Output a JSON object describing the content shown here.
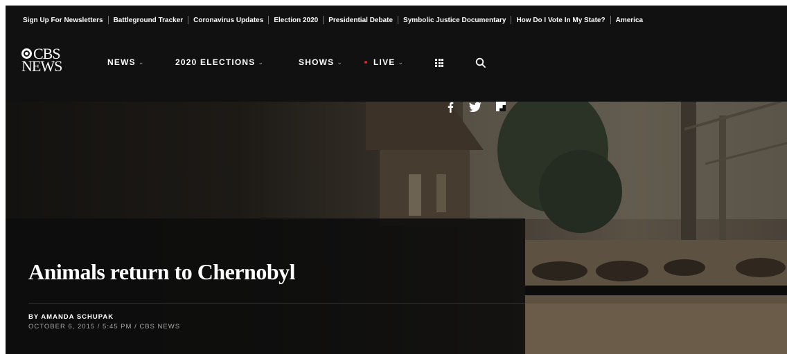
{
  "topbar": {
    "links": [
      "Sign Up For Newsletters",
      "Battleground Tracker",
      "Coronavirus Updates",
      "Election 2020",
      "Presidential Debate",
      "Symbolic Justice Documentary",
      "How Do I Vote In My State?",
      "America"
    ]
  },
  "logo": {
    "line1": "CBS",
    "line2": "NEWS"
  },
  "nav": {
    "news": "NEWS",
    "elections": "2020 ELECTIONS",
    "shows": "SHOWS",
    "live": "LIVE",
    "chevron": "⌄"
  },
  "icons": {
    "grid": "grid-icon",
    "search": "search-icon",
    "facebook": "facebook-icon",
    "twitter": "twitter-icon",
    "flipboard": "flipboard-icon"
  },
  "colors": {
    "live_dot": "#e0242b",
    "background": "#111111"
  },
  "article": {
    "headline": "Animals return to Chernobyl",
    "byline": "BY AMANDA SCHUPAK",
    "dateline": "OCTOBER 6, 2015 / 5:45 PM / CBS NEWS"
  }
}
